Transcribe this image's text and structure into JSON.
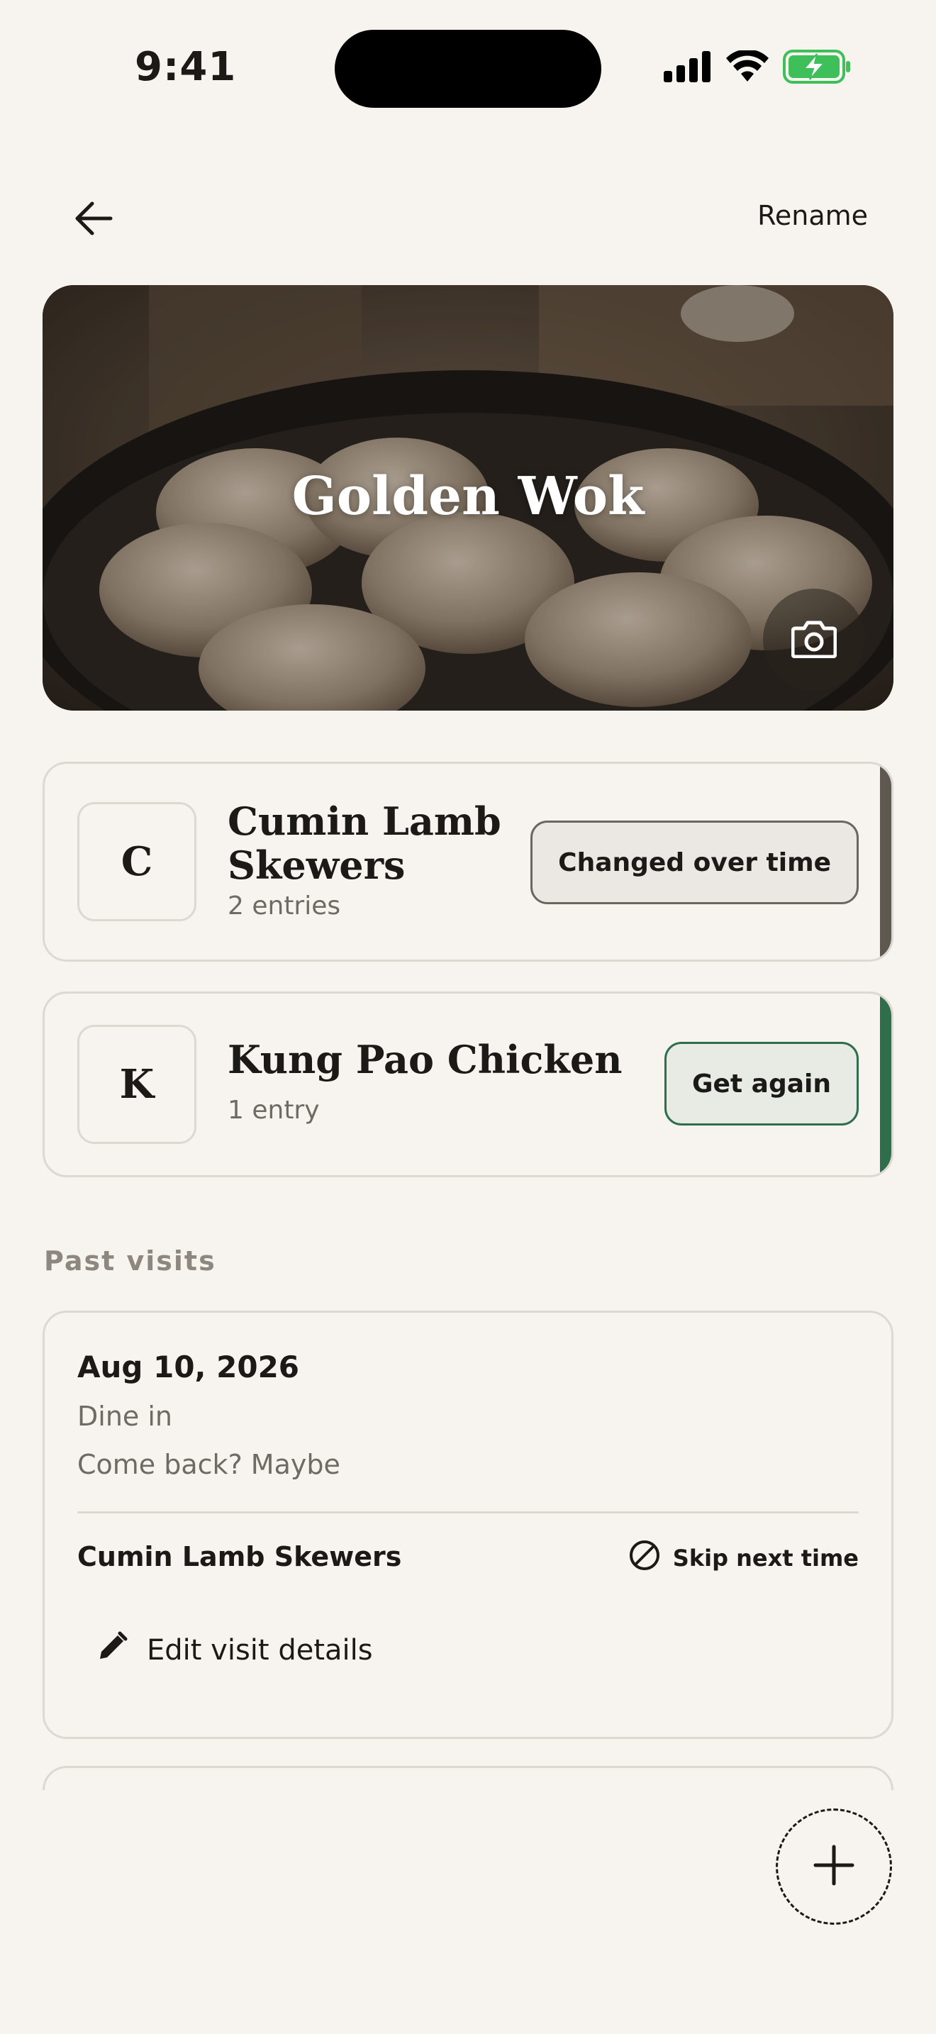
{
  "status_bar": {
    "time": "9:41",
    "icons": [
      "cellular-signal-icon",
      "wifi-icon",
      "battery-charging-icon"
    ],
    "battery_color": "#3fbf5a"
  },
  "nav": {
    "back_icon": "arrow-left-icon",
    "rename_label": "Rename"
  },
  "hero": {
    "restaurant_name": "Golden Wok",
    "camera_icon": "camera-icon"
  },
  "dishes": [
    {
      "initial": "C",
      "name_line1": "Cumin Lamb",
      "name_line2": "Skewers",
      "entries": "2 entries",
      "action_label": "Changed over time",
      "accent_color": "#5e5851"
    },
    {
      "initial": "K",
      "name": "Kung Pao Chicken",
      "entries": "1 entry",
      "action_label": "Get again",
      "accent_color": "#2f6e4b"
    }
  ],
  "past_visits": {
    "section_label": "Past visits",
    "visits": [
      {
        "date": "Aug 10, 2026",
        "type": "Dine in",
        "come_back": "Come back? Maybe",
        "dish": "Cumin Lamb Skewers",
        "verdict": "Skip next time",
        "verdict_icon": "prohibited-icon",
        "edit_label": "Edit visit details",
        "edit_icon": "pencil-icon"
      }
    ]
  },
  "fab": {
    "icon": "plus-icon"
  }
}
